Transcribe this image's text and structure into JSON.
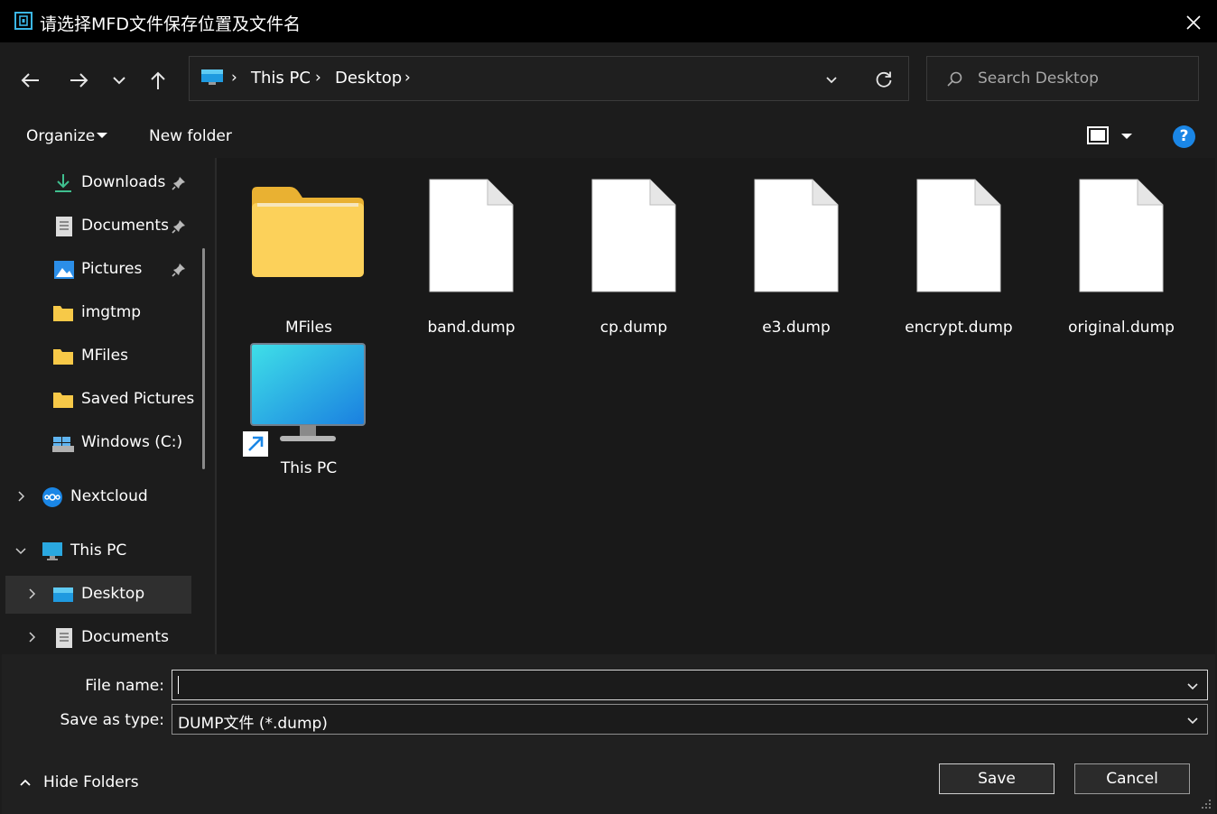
{
  "window": {
    "title": "请选择MFD文件保存位置及文件名",
    "close_icon": "close-icon"
  },
  "navigation": {
    "back_icon": "arrow-left-icon",
    "forward_icon": "arrow-right-icon",
    "recent_icon": "chevron-down-icon",
    "up_icon": "arrow-up-icon"
  },
  "address": {
    "breadcrumbs": [
      "This PC",
      "Desktop"
    ],
    "separator": "›"
  },
  "search": {
    "placeholder": "Search Desktop"
  },
  "toolbar": {
    "organize_label": "Organize",
    "new_folder_label": "New folder",
    "help_label": "?"
  },
  "sidebar": {
    "items": [
      {
        "label": "Downloads",
        "icon": "download-icon",
        "pinned": true
      },
      {
        "label": "Documents",
        "icon": "document-icon",
        "pinned": true
      },
      {
        "label": "Pictures",
        "icon": "pictures-icon",
        "pinned": true
      },
      {
        "label": "imgtmp",
        "icon": "folder-icon"
      },
      {
        "label": "MFiles",
        "icon": "folder-icon"
      },
      {
        "label": "Saved Pictures",
        "icon": "folder-icon"
      },
      {
        "label": "Windows (C:)",
        "icon": "drive-icon"
      },
      {
        "label": "Nextcloud",
        "icon": "nextcloud-icon",
        "expandable": true
      },
      {
        "label": "This PC",
        "icon": "monitor-icon",
        "expanded": true
      },
      {
        "label": "Desktop",
        "icon": "desktop-icon",
        "selected": true,
        "expandable": true
      },
      {
        "label": "Documents",
        "icon": "document-icon",
        "expandable": true
      }
    ]
  },
  "files": [
    {
      "name": "MFiles",
      "type": "folder"
    },
    {
      "name": "band.dump",
      "type": "file"
    },
    {
      "name": "cp.dump",
      "type": "file"
    },
    {
      "name": "e3.dump",
      "type": "file"
    },
    {
      "name": "encrypt.dump",
      "type": "file"
    },
    {
      "name": "original.dump",
      "type": "file"
    },
    {
      "name": "This PC",
      "type": "shortcut"
    }
  ],
  "form": {
    "file_name_label": "File name:",
    "file_name_value": "",
    "save_type_label": "Save as type:",
    "save_type_value": "DUMP文件 (*.dump)"
  },
  "footer": {
    "hide_folders_label": "Hide Folders",
    "save_label": "Save",
    "cancel_label": "Cancel"
  },
  "colors": {
    "accent": "#1a86e6",
    "folder": "#f7c948",
    "background": "#1c1c1c",
    "titlebar": "#000000"
  }
}
